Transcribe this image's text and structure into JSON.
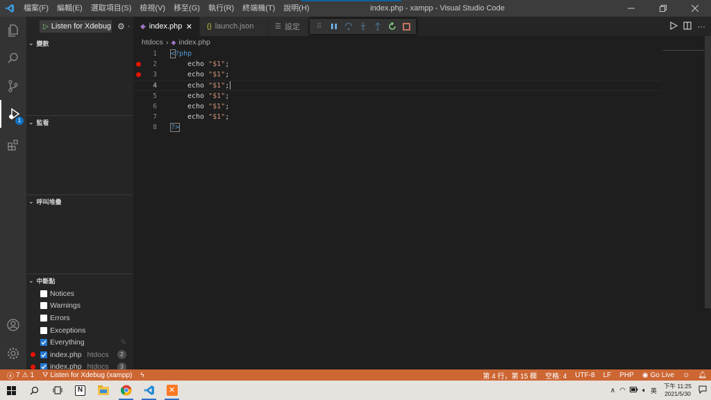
{
  "titlebar": {
    "menu": [
      "檔案(F)",
      "編輯(E)",
      "選取項目(S)",
      "檢視(V)",
      "移至(G)",
      "執行(R)",
      "終端機(T)",
      "說明(H)"
    ],
    "window_title": "index.php - xampp - Visual Studio Code"
  },
  "activitybar": {
    "items": [
      "files-icon",
      "search-icon",
      "source-control-icon",
      "run-debug-icon",
      "extensions-icon"
    ],
    "debug_badge": "1",
    "bottom": [
      "account-icon",
      "settings-gear-icon"
    ]
  },
  "sidebar": {
    "launch_config": "Listen for Xdebug",
    "sections": {
      "variables": "變數",
      "watch": "監看",
      "callstack": "呼叫堆疊",
      "breakpoints": "中斷點"
    },
    "breakpoints": [
      {
        "label": "Notices",
        "checked": false
      },
      {
        "label": "Warnings",
        "checked": false
      },
      {
        "label": "Errors",
        "checked": false
      },
      {
        "label": "Exceptions",
        "checked": false
      },
      {
        "label": "Everything",
        "checked": true
      },
      {
        "label": "index.php",
        "path": "htdocs",
        "line": "2",
        "checked": true
      },
      {
        "label": "index.php",
        "path": "htdocs",
        "line": "3",
        "checked": true
      }
    ]
  },
  "tabs": [
    {
      "label": "index.php",
      "active": true
    },
    {
      "label": "launch.json",
      "active": false
    },
    {
      "label": "設定",
      "active": false
    }
  ],
  "breadcrumb": {
    "folder": "htdocs",
    "file": "index.php"
  },
  "editor": {
    "lines": [
      {
        "no": "1",
        "text": "<?php"
      },
      {
        "no": "2",
        "text": "echo \"$1\";",
        "breakpoint": true
      },
      {
        "no": "3",
        "text": "echo \"$1\";",
        "breakpoint": true
      },
      {
        "no": "4",
        "text": "echo \"$1\";",
        "current": true
      },
      {
        "no": "5",
        "text": "echo \"$1\";"
      },
      {
        "no": "6",
        "text": "echo \"$1\";"
      },
      {
        "no": "7",
        "text": "echo \"$1\";"
      },
      {
        "no": "8",
        "text": "?>"
      }
    ]
  },
  "statusbar": {
    "errors": "7",
    "warnings": "1",
    "debug_target": "Listen for Xdebug (xampp)",
    "position": "第 4 行，第 15 欄",
    "indent": "空格: 4",
    "encoding": "UTF-8",
    "eol": "LF",
    "language": "PHP",
    "golive": "Go Live",
    "color": "#cc6633"
  },
  "taskbar": {
    "ime": "英",
    "time": "下午 11:25",
    "date": "2021/5/30"
  }
}
